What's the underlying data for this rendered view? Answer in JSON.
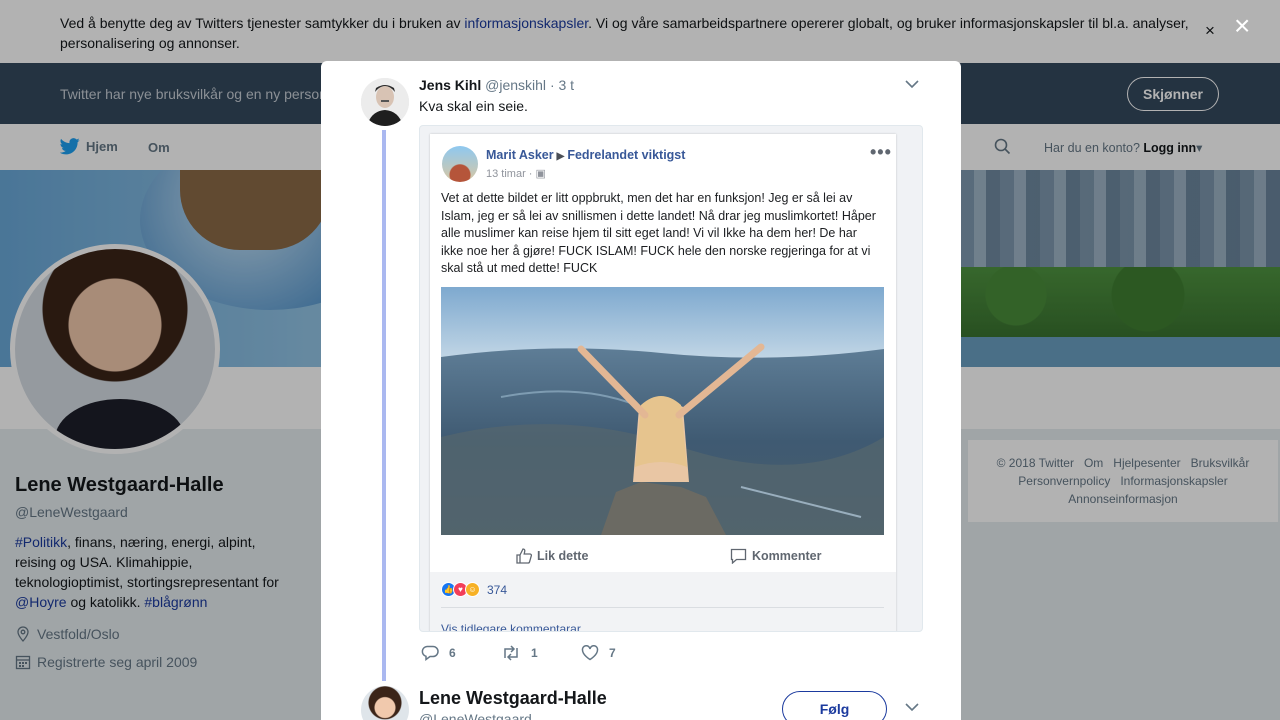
{
  "cookie_bar": {
    "text_before": "Ved å benytte deg av Twitters tjenester samtykker du i bruken av ",
    "link": "informasjonskapsler",
    "text_after": ". Vi og våre samarbeidspartnere opererer globalt, og bruker informasjonskapsler til bl.a. analyser, personalisering og annonser.",
    "close": "×"
  },
  "terms_bar": {
    "text": "Twitter har nye bruksvilkår og en ny personvernpolicy",
    "button": "Skjønner"
  },
  "nav": {
    "home": "Hjem",
    "about": "Om",
    "login_prompt": "Har du en konto?",
    "login": "Logg inn"
  },
  "profile": {
    "name": "Lene Westgaard-Halle",
    "handle": "@LeneWestgaard",
    "bio_tag1": "#Politikk",
    "bio_mid": ", finans, næring, energi, alpint, reising og USA. Klimahippie, teknologioptimist, stortingsrepresentant for ",
    "bio_mention": "@Hoyre",
    "bio_and": " og katolikk. ",
    "bio_tag2": "#blågrønn",
    "location": "Vestfold/Oslo",
    "joined": "Registrerte seg april 2009"
  },
  "footer": {
    "copyright": "© 2018 Twitter",
    "about": "Om",
    "help": "Hjelpesenter",
    "terms": "Bruksvilkår",
    "privacy": "Personvernpolicy",
    "cookies": "Informasjonskapsler",
    "ads": "Annonseinformasjon"
  },
  "overlay_close": "×",
  "tweet": {
    "name": "Jens Kihl",
    "handle": "@jenskihl",
    "time": "· 3 t",
    "text": "Kva skal ein seie.",
    "replies": "6",
    "retweets": "1",
    "likes": "7"
  },
  "fb_post": {
    "author": "Marit Asker",
    "group": "Fedrelandet viktigst",
    "time": "13 timar · ▣",
    "more": "•••",
    "text": "Vet at dette bildet er litt oppbrukt, men det har en funksjon! Jeg er så lei av Islam, jeg er så lei av snillismen i dette landet! Nå drar jeg muslimkortet! Håper alle muslimer kan reise hjem til sitt eget land! Vi vil Ikke ha dem her! De har ikke noe her å gjøre! FUCK ISLAM! FUCK hele den norske regjeringa for at vi skal stå ut med dette! FUCK",
    "like": "Lik dette",
    "comment": "Kommenter",
    "reaction_count": "374",
    "more_comments": "Vis tidlegare kommentarar"
  },
  "next_tweet": {
    "name": "Lene Westgaard-Halle",
    "handle": "@LeneWestgaard",
    "follow": "Følg"
  },
  "colors": {
    "link": "#1b3a9e",
    "fb_blue": "#385898",
    "thread_line": "#aab8f0"
  }
}
